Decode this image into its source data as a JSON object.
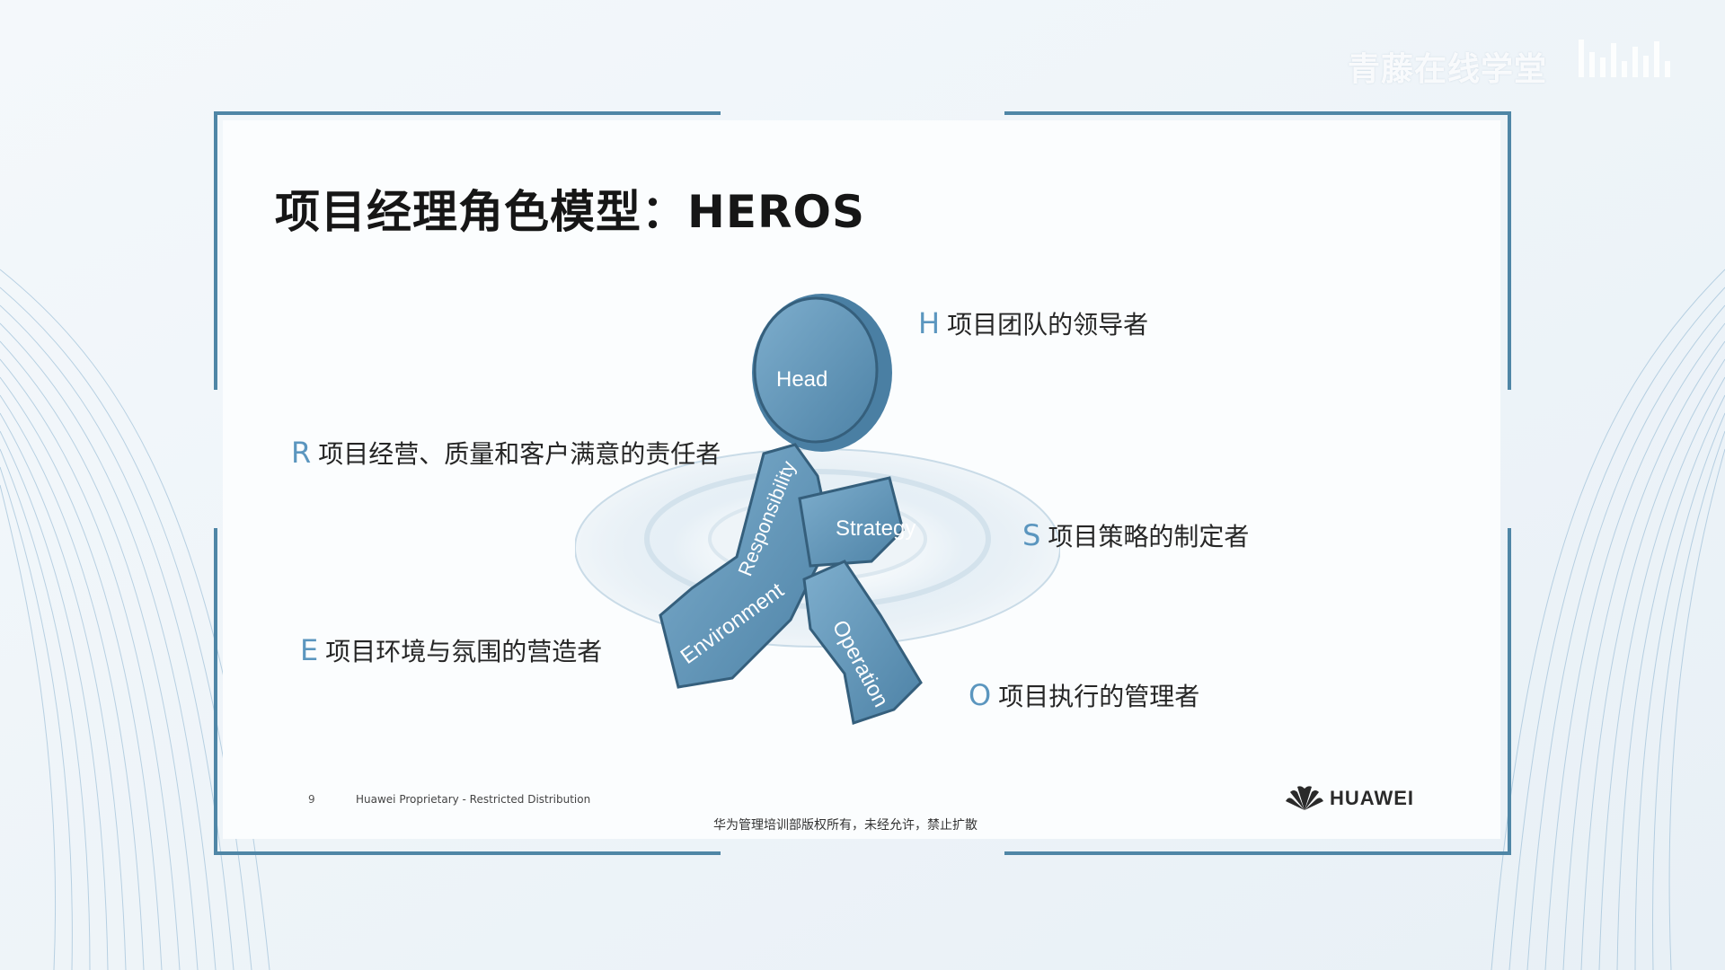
{
  "watermark": "青藤在线学堂",
  "slide": {
    "title": "项目经理角色模型：HEROS",
    "figure_labels": {
      "head": "Head",
      "responsibility": "Responsibility",
      "strategy": "Strategy",
      "environment": "Environment",
      "operation": "Operation"
    },
    "roles": [
      {
        "letter": "H",
        "text": "项目团队的领导者"
      },
      {
        "letter": "R",
        "text": "项目经营、质量和客户满意的责任者"
      },
      {
        "letter": "S",
        "text": "项目策略的制定者"
      },
      {
        "letter": "E",
        "text": "项目环境与氛围的营造者"
      },
      {
        "letter": "O",
        "text": "项目执行的管理者"
      }
    ]
  },
  "footer": {
    "page_number": "9",
    "proprietary": "Huawei Proprietary - Restricted Distribution",
    "copyright": "华为管理培训部版权所有，未经允许，禁止扩散",
    "logo_text": "HUAWEI"
  },
  "colors": {
    "frame": "#4f86a6",
    "figure": "#5f93b6",
    "accent_letter": "#5b96bf"
  }
}
